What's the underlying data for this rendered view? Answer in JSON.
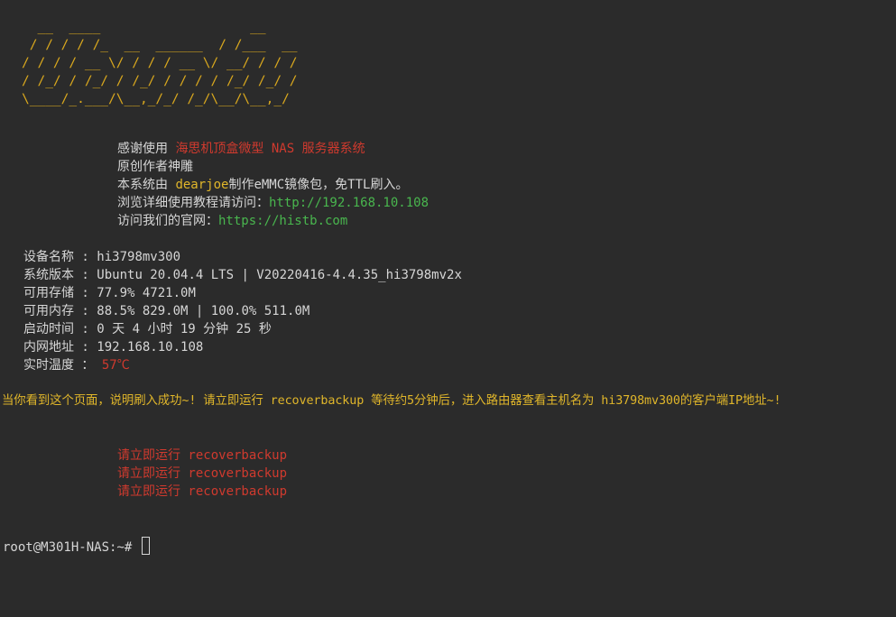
{
  "ascii_banner": "  __  ____                   __\n / / / / /_  __  ______  / /___  __\n/ / / / __ \\/ / / / __ \\/ __/ / / /\n/ /_/ / /_/ / /_/ / / / / /_/ /_/ /\n\\____/_.___/\\__,_/_/ /_/\\__/\\__,_/",
  "intro": {
    "line1_prefix": "感谢使用 ",
    "line1_highlight": "海思机顶盒微型 NAS 服务器系统",
    "line2": "原创作者神雕",
    "line3_prefix": "本系统由 ",
    "line3_highlight": "dearjoe",
    "line3_suffix": "制作eMMC镜像包，免TTL刷入。",
    "line4_prefix": "浏览详细使用教程请访问：",
    "line4_link": "http://192.168.10.108",
    "line5_prefix": "访问我们的官网：",
    "line5_link": "https://histb.com"
  },
  "sysinfo": {
    "device_label": "设备名称 : ",
    "device_value": "hi3798mv300",
    "version_label": "系统版本 : ",
    "version_value": "Ubuntu 20.04.4 LTS | V20220416-4.4.35_hi3798mv2x",
    "storage_label": "可用存储 : ",
    "storage_value": "77.9% 4721.0M",
    "memory_label": "可用内存 : ",
    "memory_value": "88.5% 829.0M | 100.0% 511.0M",
    "uptime_label": "启动时间 : ",
    "uptime_value": "0 天 4 小时 19 分钟 25 秒",
    "ip_label": "内网地址 : ",
    "ip_value": "192.168.10.108",
    "temp_label": "实时温度 ： ",
    "temp_value": "57℃"
  },
  "notice": "当你看到这个页面，说明刷入成功~! 请立即运行 recoverbackup 等待约5分钟后，进入路由器查看主机名为 hi3798mv300的客户端IP地址~!",
  "reminders": [
    "请立即运行 recoverbackup",
    "请立即运行 recoverbackup",
    "请立即运行 recoverbackup"
  ],
  "prompt": "root@M301H-NAS:~#",
  "colors": {
    "background": "#2b2b2b",
    "banner": "#d9a81e",
    "highlight_yellow": "#e0b62a",
    "highlight_red": "#d03a2e",
    "link_green": "#49b64e",
    "text": "#d6d6d6"
  }
}
